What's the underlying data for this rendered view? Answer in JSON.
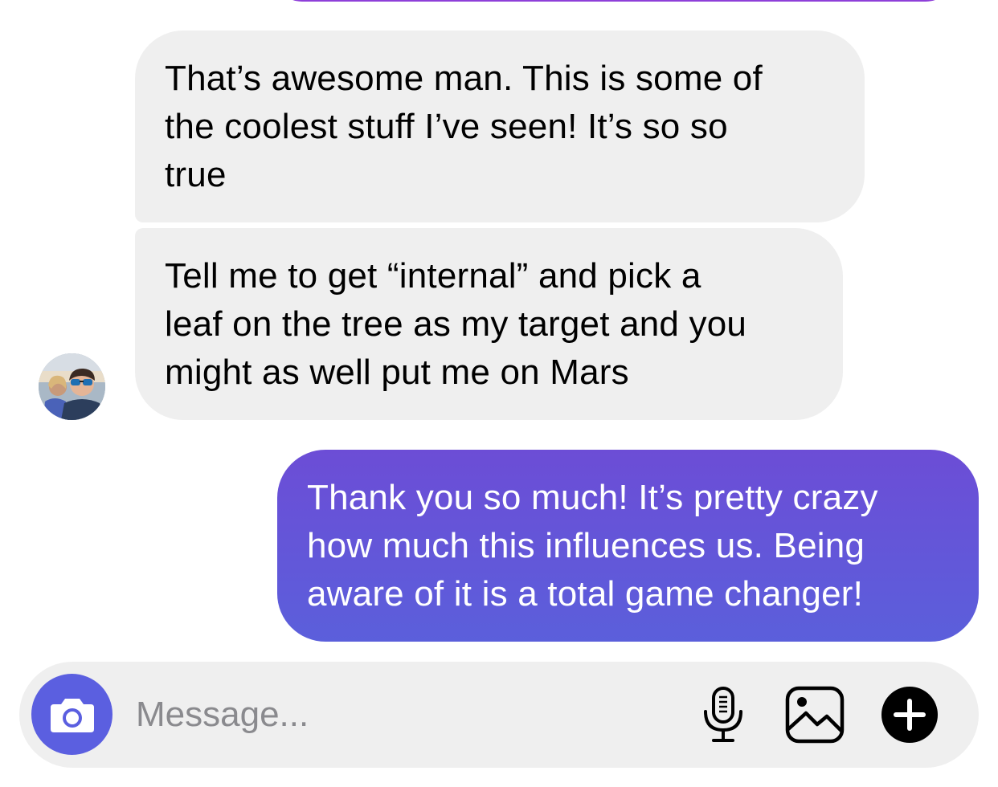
{
  "thread": {
    "messages": [
      {
        "direction": "incoming",
        "lines": [
          "That’s awesome man.  This is some of",
          "the coolest stuff I’ve seen!  It’s so so",
          "true"
        ]
      },
      {
        "direction": "incoming",
        "lines": [
          "Tell me to get “internal” and pick a",
          "leaf on the tree as my target and you",
          "might as well put me on Mars"
        ]
      },
      {
        "direction": "outgoing",
        "lines": [
          "Thank you so much! It’s pretty crazy",
          "how much this influences us. Being",
          "aware of it is a total game changer!"
        ]
      }
    ]
  },
  "composer": {
    "placeholder": "Message...",
    "value": "",
    "icons": {
      "camera": "camera-icon",
      "mic": "microphone-icon",
      "gallery": "image-icon",
      "plus": "plus-circle-icon"
    }
  },
  "colors": {
    "incoming_bubble": "#efefef",
    "outgoing_bubble_top": "#6c4dd6",
    "outgoing_bubble_bottom": "#5b5fdb",
    "camera_button": "#5b5fe0",
    "composer_background": "#efefef",
    "placeholder_text": "#8a8a8e"
  }
}
